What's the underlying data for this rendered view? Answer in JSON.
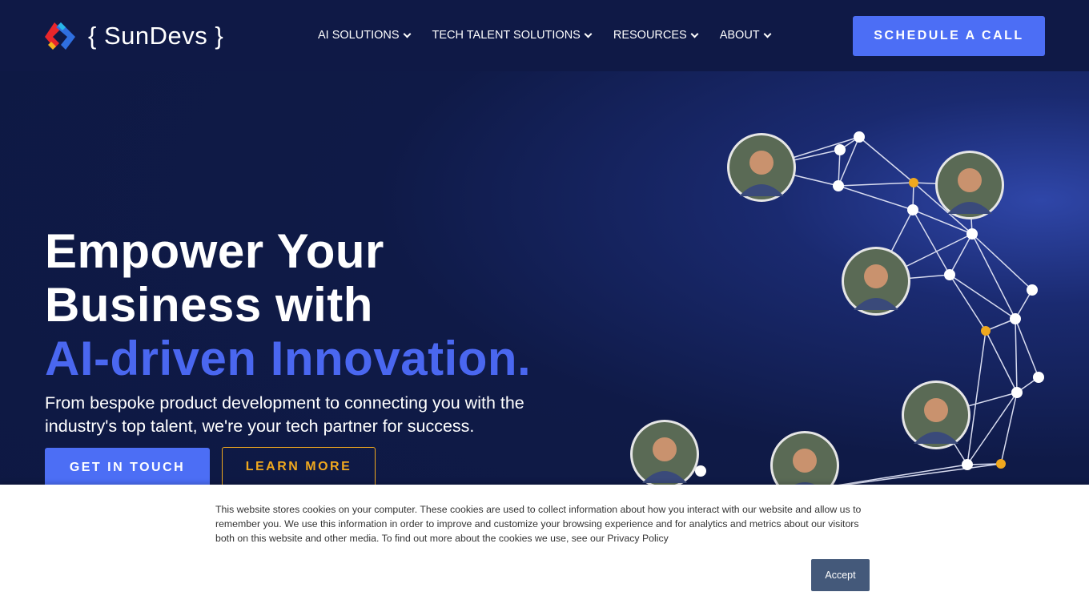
{
  "header": {
    "logo_text": "{ SunDevs }",
    "nav": [
      {
        "label": "AI SOLUTIONS"
      },
      {
        "label": "TECH TALENT SOLUTIONS"
      },
      {
        "label": "RESOURCES"
      },
      {
        "label": "ABOUT"
      }
    ],
    "cta_label": "SCHEDULE A CALL"
  },
  "hero": {
    "title_line1": "Empower Your",
    "title_line2": "Business with",
    "title_accent": "AI-driven Innovation.",
    "subtitle": "From bespoke product development to connecting you with the industry's top talent, we're your tech partner for success.",
    "primary_button": "GET IN TOUCH",
    "secondary_button": "LEARN MORE"
  },
  "cookie_banner": {
    "text": "This website stores cookies on your computer. These cookies are used to collect information about how you interact with our website and allow us to remember you. We use this information in order to improve and customize your browsing experience and for analytics and metrics about our visitors both on this website and other media. To find out more about the cookies we use, see our Privacy Policy",
    "accept_label": "Accept"
  },
  "colors": {
    "accent": "#4c6ef5",
    "secondary": "#f0a81e",
    "background": "#0e1842",
    "accept_button": "#44597a"
  }
}
